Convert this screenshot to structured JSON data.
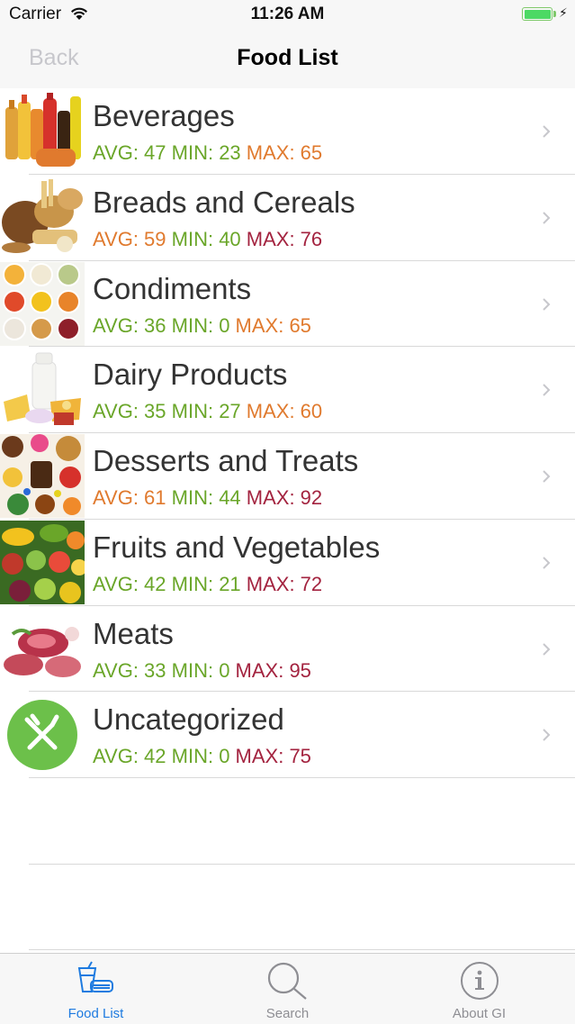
{
  "status_bar": {
    "carrier": "Carrier",
    "time": "11:26 AM"
  },
  "nav": {
    "back_label": "Back",
    "title": "Food List"
  },
  "colors": {
    "green": "#6aa629",
    "orange": "#e07a2e",
    "red": "#a3233f",
    "active_tab": "#1e7be0",
    "inactive_tab": "#8e8e93"
  },
  "rows": [
    {
      "title": "Beverages",
      "avg": "AVG: 47",
      "min": "MIN: 23",
      "max": "MAX: 65",
      "avg_color": "green",
      "min_color": "green",
      "max_color": "orange",
      "icon": "beverages-thumbnail"
    },
    {
      "title": "Breads and Cereals",
      "avg": "AVG: 59",
      "min": "MIN: 40",
      "max": "MAX: 76",
      "avg_color": "orange",
      "min_color": "green",
      "max_color": "red",
      "icon": "breads-thumbnail"
    },
    {
      "title": "Condiments",
      "avg": "AVG: 36",
      "min": "MIN: 0",
      "max": "MAX: 65",
      "avg_color": "green",
      "min_color": "green",
      "max_color": "orange",
      "icon": "condiments-thumbnail"
    },
    {
      "title": "Dairy Products",
      "avg": "AVG: 35",
      "min": "MIN: 27",
      "max": "MAX: 60",
      "avg_color": "green",
      "min_color": "green",
      "max_color": "orange",
      "icon": "dairy-thumbnail"
    },
    {
      "title": "Desserts and Treats",
      "avg": "AVG: 61",
      "min": "MIN: 44",
      "max": "MAX: 92",
      "avg_color": "orange",
      "min_color": "green",
      "max_color": "red",
      "icon": "desserts-thumbnail"
    },
    {
      "title": "Fruits and Vegetables",
      "avg": "AVG: 42",
      "min": "MIN: 21",
      "max": "MAX: 72",
      "avg_color": "green",
      "min_color": "green",
      "max_color": "red",
      "icon": "fruits-thumbnail"
    },
    {
      "title": "Meats",
      "avg": "AVG: 33",
      "min": "MIN: 0",
      "max": "MAX: 95",
      "avg_color": "green",
      "min_color": "green",
      "max_color": "red",
      "icon": "meats-thumbnail"
    },
    {
      "title": "Uncategorized",
      "avg": "AVG: 42",
      "min": "MIN: 0",
      "max": "MAX: 75",
      "avg_color": "green",
      "min_color": "green",
      "max_color": "red",
      "icon": "fork-knife-icon"
    }
  ],
  "tabs": [
    {
      "label": "Food List",
      "icon": "food-list-icon",
      "active": true
    },
    {
      "label": "Search",
      "icon": "search-icon",
      "active": false
    },
    {
      "label": "About GI",
      "icon": "info-icon",
      "active": false
    }
  ]
}
